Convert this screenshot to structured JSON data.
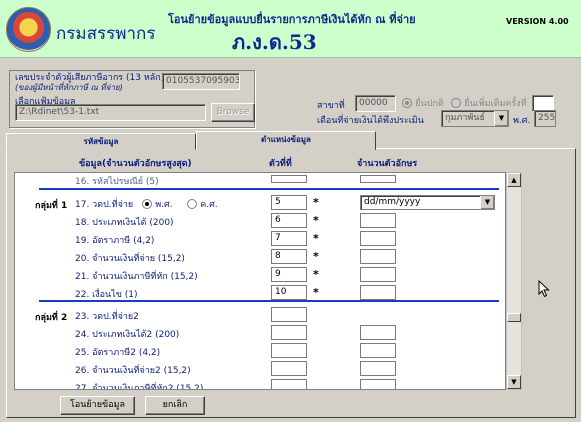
{
  "header": {
    "org_name": "กรมสรรพากร",
    "title": "โอนย้ายข้อมูลแบบยื่นรายการภาษีเงินได้หัก ณ ที่จ่าย",
    "form_code": "ภ.ง.ด.53",
    "version": "VERSION 4.00"
  },
  "taxpayer": {
    "id_label": "เลขประจำตัวผู้เสียภาษีอากร (13 หลัก)",
    "id_note": "(ของผู้มีหน้าที่หักภาษี ณ ที่จ่าย)",
    "id_value": "0105537095903",
    "file_label": "เลือกแฟ้มข้อมูล",
    "file_value": "Z:\\Rdinet\\53-1.txt",
    "browse_label": "Browse"
  },
  "branch": {
    "label": "สาขาที่",
    "value": "00000",
    "normal_label": "ยื่นปกติ",
    "additional_label": "ยื่นเพิ่มเติมครั้งที่",
    "additional_value": ""
  },
  "period": {
    "label": "เดือนที่จ่ายเงินได้พึงประเมิน",
    "month": "กุมภาพันธ์",
    "year_label": "พ.ศ.",
    "year": "2555"
  },
  "tabs": [
    "รหัสข้อมูล",
    "ตำแหน่งข้อมูล"
  ],
  "columns": {
    "data_header": "ข้อมูล(จำนวนตัวอักษรสูงสุด)",
    "position_header": "ตัวที่ที่",
    "length_header": "จำนวนตัวอักษร"
  },
  "grid": {
    "partial_row": "16. รหัสไปรษณีย์ (5)",
    "group1_label": "กลุ่มที่ 1",
    "group2_label": "กลุ่มที่ 2",
    "era_be": "พ.ศ.",
    "era_ce": "ค.ศ.",
    "date_format": "dd/mm/yyyy",
    "star": "*",
    "group1_rows": [
      {
        "label": "17. วดป.ที่จ่าย",
        "pos": "5"
      },
      {
        "label": "18. ประเภทเงินได้ (200)",
        "pos": "6"
      },
      {
        "label": "19. อัตราภาษี (4,2)",
        "pos": "7"
      },
      {
        "label": "20. จำนวนเงินที่จ่าย (15,2)",
        "pos": "8"
      },
      {
        "label": "21. จำนวนเงินภาษีที่หัก (15,2)",
        "pos": "9"
      },
      {
        "label": "22. เงื่อนไข (1)",
        "pos": "10"
      }
    ],
    "group2_rows": [
      {
        "label": "23. วดป.ที่จ่าย2",
        "pos": ""
      },
      {
        "label": "24. ประเภทเงินได้2 (200)",
        "pos": ""
      },
      {
        "label": "25. อัตราภาษี2 (4,2)",
        "pos": ""
      },
      {
        "label": "26. จำนวนเงินที่จ่าย2 (15,2)",
        "pos": ""
      },
      {
        "label": "27. จำนวนเงินภาษีที่หัก2 (15,2)",
        "pos": ""
      }
    ]
  },
  "buttons": {
    "transfer": "โอนย้ายข้อมูล",
    "cancel": "ยกเลิก"
  },
  "icons": {
    "logo": "revenue-department-seal",
    "scroll_up": "arrow-up-icon",
    "scroll_down": "arrow-down-icon",
    "cursor": "mouse-pointer-icon"
  },
  "colors": {
    "header_bg": "#ccffcc",
    "title_blue": "#0b2a8f",
    "divider_blue": "#1a3cc4"
  }
}
